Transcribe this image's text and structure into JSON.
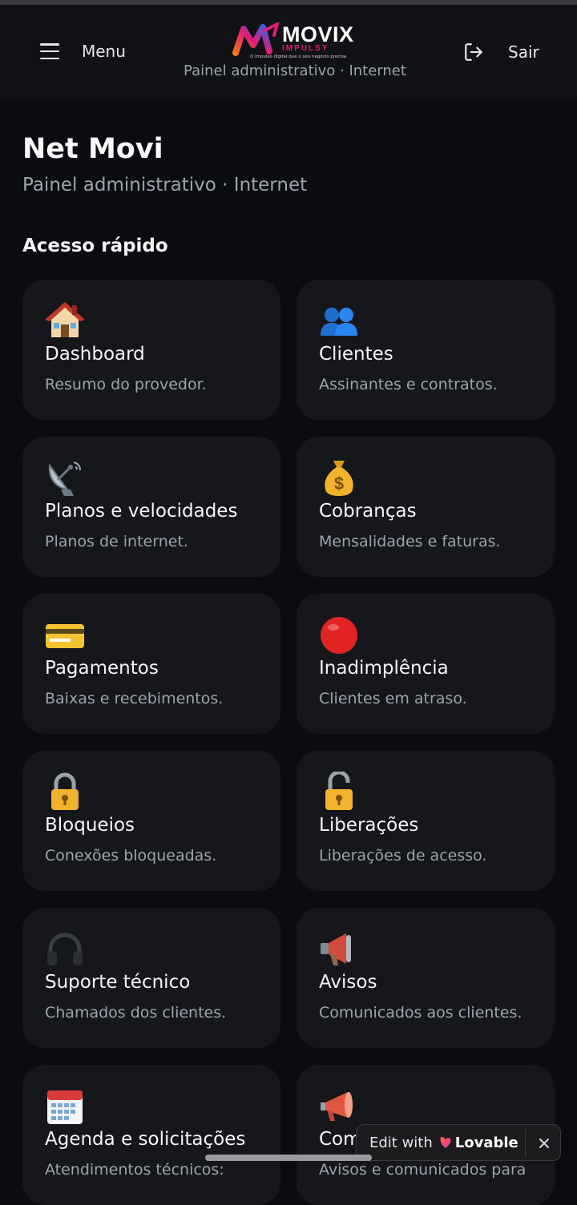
{
  "header": {
    "menu_label": "Menu",
    "logout_label": "Sair",
    "logo_name": "MOVIX",
    "logo_sub": "IMPULSY",
    "logo_tagline": "O impulso digital que o seu negócio precisa",
    "subtitle": "Painel administrativo · Internet"
  },
  "page": {
    "title": "Net Movi",
    "subtitle": "Painel administrativo · Internet",
    "section_title": "Acesso rápido"
  },
  "cards": [
    {
      "icon": "house-icon",
      "title": "Dashboard",
      "desc": "Resumo do provedor."
    },
    {
      "icon": "people-icon",
      "title": "Clientes",
      "desc": "Assinantes e contratos."
    },
    {
      "icon": "satellite-dish-icon",
      "title": "Planos e velocidades",
      "desc": "Planos de internet."
    },
    {
      "icon": "money-bag-icon",
      "title": "Cobranças",
      "desc": "Mensalidades e faturas."
    },
    {
      "icon": "credit-card-icon",
      "title": "Pagamentos",
      "desc": "Baixas e recebimentos."
    },
    {
      "icon": "red-circle-icon",
      "title": "Inadimplência",
      "desc": "Clientes em atraso."
    },
    {
      "icon": "lock-icon",
      "title": "Bloqueios",
      "desc": "Conexões bloqueadas."
    },
    {
      "icon": "unlock-icon",
      "title": "Liberações",
      "desc": "Liberações de acesso."
    },
    {
      "icon": "headphones-icon",
      "title": "Suporte técnico",
      "desc": "Chamados dos clientes."
    },
    {
      "icon": "loudspeaker-icon",
      "title": "Avisos",
      "desc": "Comunicados aos clientes."
    },
    {
      "icon": "calendar-icon",
      "title": "Agenda e solicitações",
      "desc": "Atendimentos técnicos:"
    },
    {
      "icon": "megaphone-icon",
      "title": "Comunicados",
      "desc": "Avisos e comunicados para"
    }
  ],
  "lovable_badge": {
    "edit_label": "Edit with",
    "brand": "Lovable"
  },
  "colors": {
    "background": "#0b0c10",
    "card": "#16171b",
    "accent_pink": "#e11d74"
  }
}
